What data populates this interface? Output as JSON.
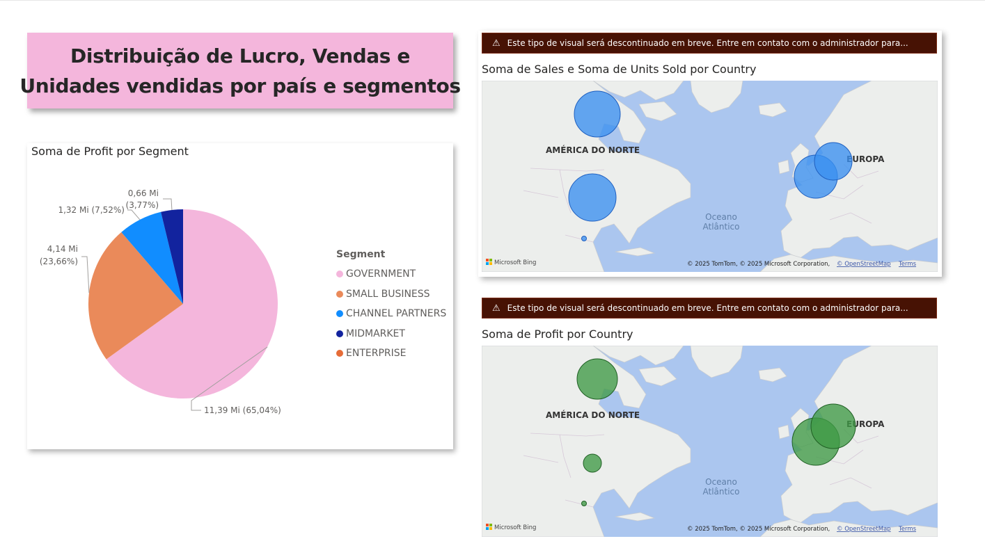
{
  "title": {
    "line1": "Distribuição de Lucro, Vendas e",
    "line2": "Unidades vendidas por país e segmentos"
  },
  "pie": {
    "title": "Soma de Profit por Segment",
    "legend_title": "Segment",
    "chart_data": {
      "type": "pie",
      "title": "Soma de Profit por Segment",
      "unit": "Mi",
      "slices": [
        {
          "label": "GOVERNMENT",
          "value": 11.39,
          "percent": 65.04,
          "color": "#f4b6dc",
          "data_label": "11,39 Mi (65,04%)"
        },
        {
          "label": "SMALL BUSINESS",
          "value": 4.14,
          "percent": 23.66,
          "color": "#ea8a5a",
          "data_label_value": "4,14 Mi",
          "data_label_pct": "(23,66%)"
        },
        {
          "label": "CHANNEL PARTNERS",
          "value": 1.32,
          "percent": 7.52,
          "color": "#118dff",
          "data_label": "1,32 Mi (7,52%)"
        },
        {
          "label": "MIDMARKET",
          "value": 0.66,
          "percent": 3.77,
          "color": "#12239e",
          "data_label_value": "0,66 Mi",
          "data_label_pct": "(3,77%)"
        },
        {
          "label": "ENTERPRISE",
          "value": 0.0,
          "percent": 0.0,
          "color": "#e66c37"
        }
      ]
    }
  },
  "map1": {
    "warning": "Este tipo de visual será descontinuado em breve. Entre em contato com o administrador para...",
    "title": "Soma de Sales e Soma de Units Sold por Country",
    "bubble_color": "#3a8ff0",
    "bubble_stroke": "#1f5fbf"
  },
  "map2": {
    "warning": "Este tipo de visual será descontinuado em breve. Entre em contato com o administrador para...",
    "title": "Soma de Profit por Country",
    "bubble_color": "#3f9a45",
    "bubble_stroke": "#1f5f23"
  },
  "map_labels": {
    "north_america": "AMÉRICA DO NORTE",
    "europe": "EUROPA",
    "ocean_1": "Oceano",
    "ocean_2": "Atlântico",
    "bing": "Microsoft Bing",
    "copyright": "© 2025 TomTom, © 2025 Microsoft Corporation,",
    "osm": "© OpenStreetMap",
    "terms": "Terms"
  },
  "colors": {
    "map_water": "#abc6ef",
    "map_land": "#eceeec",
    "warning_bg": "#471204"
  }
}
